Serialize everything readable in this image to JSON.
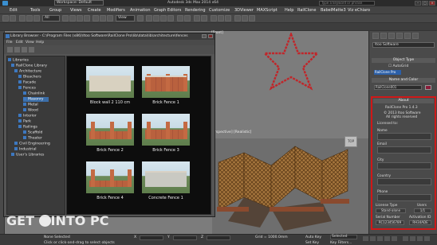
{
  "titlebar": {
    "workspace": "Workspace: Default",
    "title": "Autodesk 3ds Max 2014 x64",
    "search_placeholder": "Type a keyword or phrase"
  },
  "menu": [
    "Edit",
    "Tools",
    "Group",
    "Views",
    "Create",
    "Modifiers",
    "Animation",
    "Graph Editors",
    "Rendering",
    "Customize",
    "3DViewer",
    "MAXScript",
    "Help",
    "RailClone",
    "BabelMatte3",
    "Viz eChiaro"
  ],
  "toolbar": {
    "selection_set": "All",
    "view_dropdown": "View",
    "viewport_label": "[Perspective] [Realistic]"
  },
  "library": {
    "title": "Library Browser - C:\\Program Files (x86)\\Itoo Software\\RailClone Pro\\lib\\data\\lib\\architecture\\fences",
    "menu": [
      "File",
      "Edit",
      "View",
      "Help"
    ],
    "tree": [
      {
        "label": "Libraries",
        "level": 0
      },
      {
        "label": "RailClone Library",
        "level": 1
      },
      {
        "label": "Architecture",
        "level": 2
      },
      {
        "label": "Bleachers",
        "level": 3
      },
      {
        "label": "Facade",
        "level": 3
      },
      {
        "label": "Fences",
        "level": 3
      },
      {
        "label": "Chainlink",
        "level": 4
      },
      {
        "label": "Masonry",
        "level": 4,
        "selected": true
      },
      {
        "label": "Metal",
        "level": 4
      },
      {
        "label": "Wood",
        "level": 4
      },
      {
        "label": "Interior",
        "level": 3
      },
      {
        "label": "Park",
        "level": 3
      },
      {
        "label": "Railings",
        "level": 3
      },
      {
        "label": "Scaffold",
        "level": 4
      },
      {
        "label": "Theater",
        "level": 4
      },
      {
        "label": "Civil Engineering",
        "level": 2
      },
      {
        "label": "Industrial",
        "level": 2
      },
      {
        "label": "User's Libraries",
        "level": 1
      }
    ],
    "items": [
      "Block wall 2 110 cm",
      "Brick Fence 1",
      "Brick Fence 2",
      "Brick Fence 3",
      "Brick Fence 4",
      "Concrete Fence 1"
    ]
  },
  "panel": {
    "category_dropdown": "Itoo Software",
    "object_type_header": "Object Type",
    "autogrid_label": "AutoGrid",
    "object_button": "RailClone Pro",
    "name_color_header": "Name and Color",
    "object_name": "RailClone001",
    "about_header": "About",
    "product": "RailClone Pro 1.4.3",
    "copyright": "© 2013 Itoo Software",
    "rights": "All rights reserved",
    "licensed_to": "Licensed to:",
    "fields": [
      "Email",
      "City",
      "Country",
      "Phone"
    ],
    "name_label": "Name",
    "license_type_label": "License Type",
    "license_type_value": "Stand-alone",
    "users_label": "Users",
    "users_value": "1/1",
    "serial_label": "Serial Number",
    "serial_value": "RC123456789",
    "activation_label": "Activation ID",
    "activation_value": "RH34ADE"
  },
  "status": {
    "selection": "None Selected",
    "hint": "Click or click-and-drag to select objects",
    "grid": "Grid = 1000.0mm",
    "autokey": "Auto Key",
    "selected_dropdown": "Selected",
    "setkey": "Set Key",
    "keyfilters": "Key Filters...",
    "x_label": "X",
    "y_label": "Y",
    "z_label": "Z"
  },
  "watermark": {
    "text_left": "GET ",
    "text_right": "INTO PC"
  },
  "colors": {
    "accent": "#3b6ea8",
    "highlight_border": "#d01818",
    "star": "#c0262a"
  }
}
